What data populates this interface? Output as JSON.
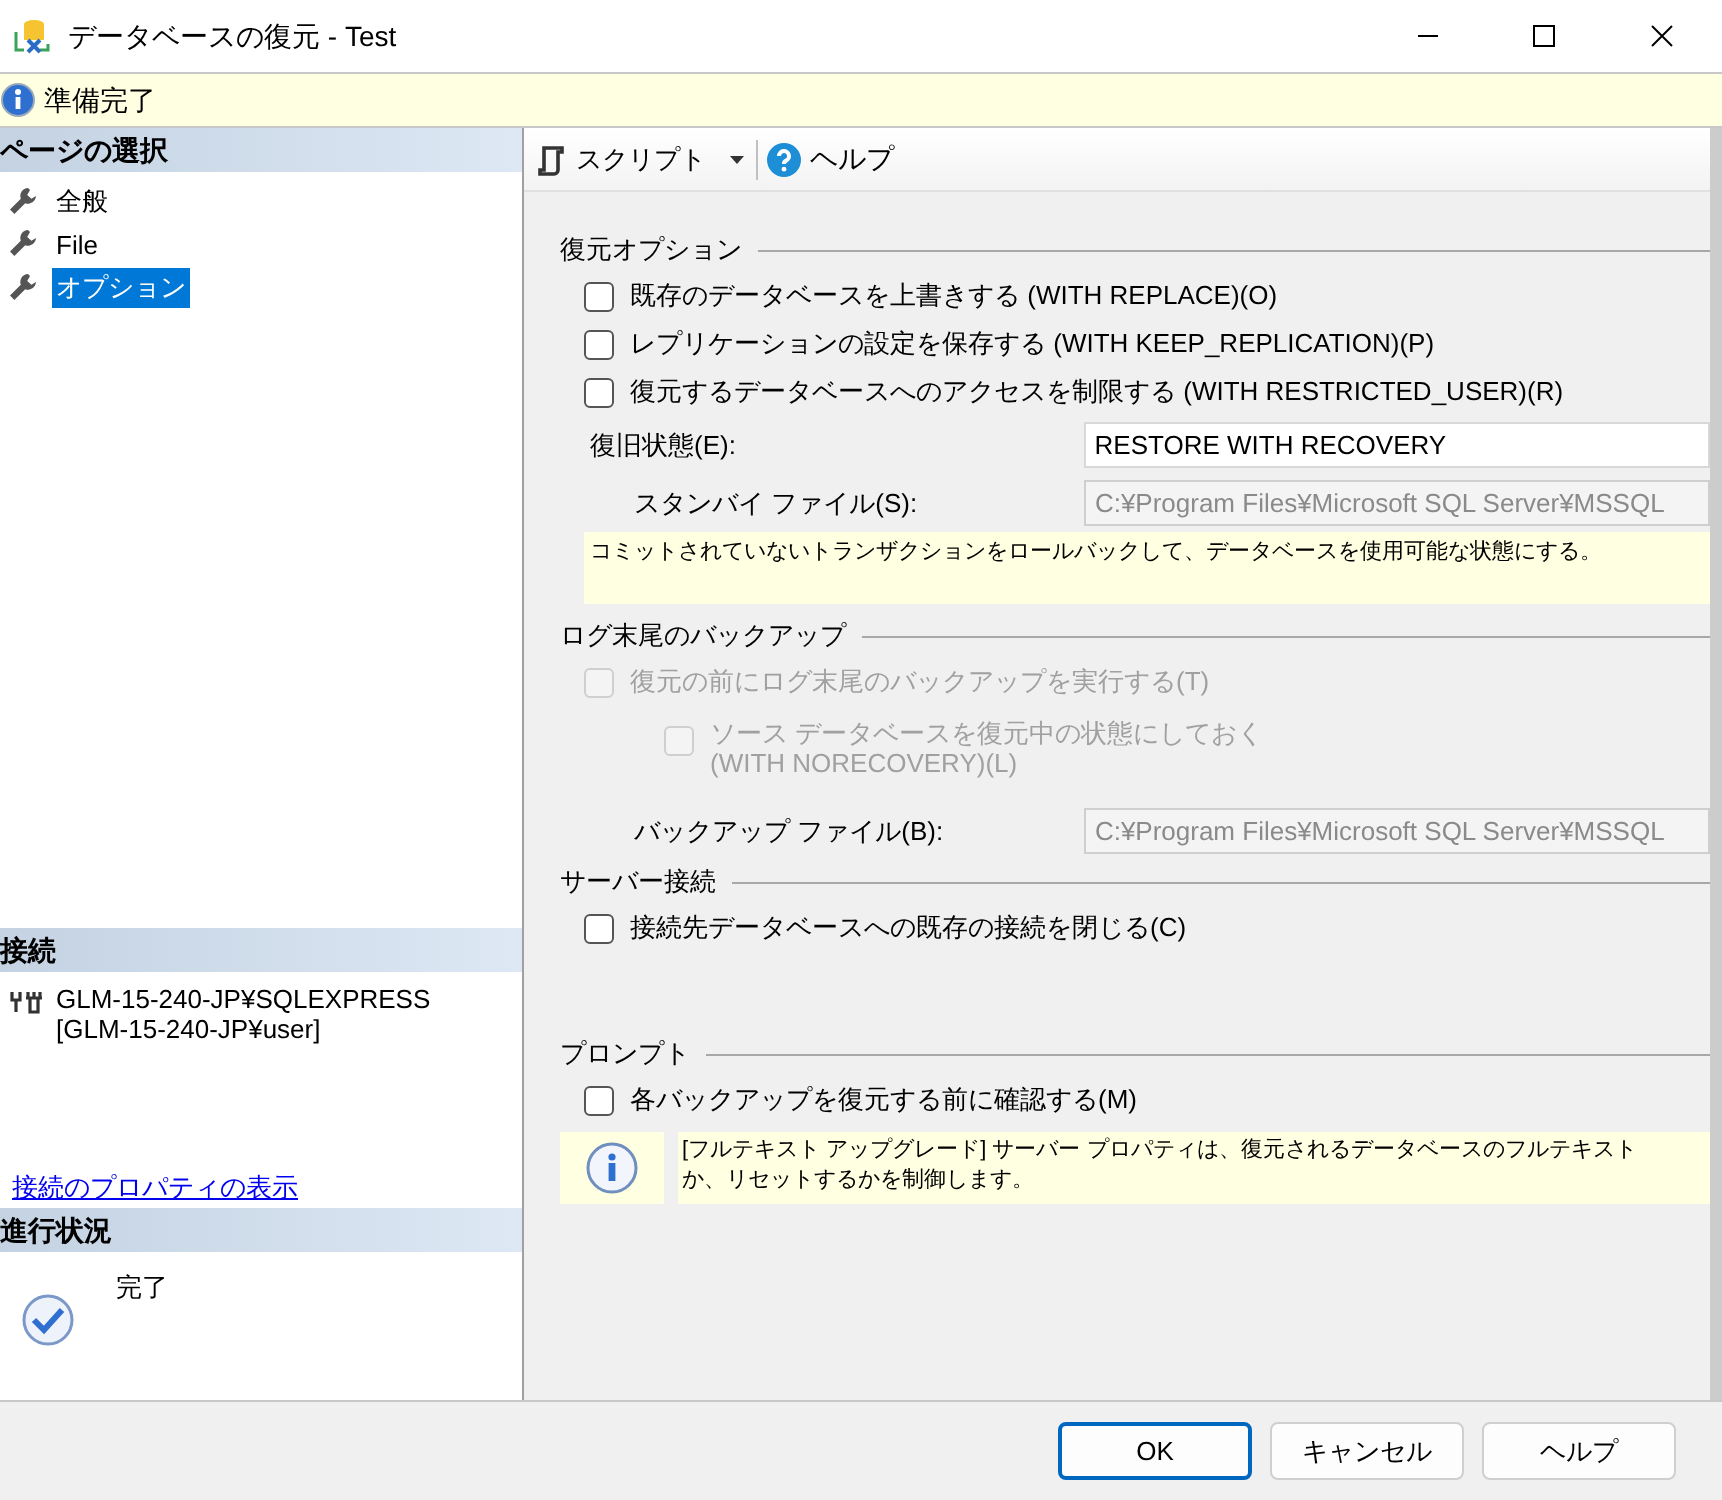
{
  "window": {
    "title": "データベースの復元 - Test"
  },
  "status": {
    "text": "準備完了"
  },
  "sidebar": {
    "pages_header": "ページの選択",
    "pages": [
      {
        "label": "全般",
        "selected": false
      },
      {
        "label": "File",
        "selected": false
      },
      {
        "label": "オプション",
        "selected": true
      }
    ],
    "connection_header": "接続",
    "connection_lines": [
      "GLM-15-240-JP¥SQLEXPRESS",
      "[GLM-15-240-JP¥user]"
    ],
    "connection_link": "接続のプロパティの表示",
    "progress_header": "進行状況",
    "progress_status": "完了"
  },
  "toolbar": {
    "script": "スクリプト",
    "help": "ヘルプ"
  },
  "sections": [
    {
      "title": "復元オプション",
      "items": [
        {
          "kind": "checkbox",
          "label": "既存のデータベースを上書きする (WITH REPLACE)(O)",
          "checked": false,
          "disabled": false
        },
        {
          "kind": "checkbox",
          "label": "レプリケーションの設定を保存する (WITH KEEP_REPLICATION)(P)",
          "checked": false,
          "disabled": false
        },
        {
          "kind": "checkbox",
          "label": "復元するデータベースへのアクセスを制限する (WITH RESTRICTED_USER)(R)",
          "checked": false,
          "disabled": false
        },
        {
          "kind": "dropdown",
          "label": "復旧状態(E):",
          "value": "RESTORE WITH RECOVERY",
          "disabled": false
        },
        {
          "kind": "field",
          "label": "スタンバイ ファイル(S):",
          "value": "C:¥Program Files¥Microsoft SQL Server¥MSSQL",
          "disabled": true
        },
        {
          "kind": "note",
          "text": "コミットされていないトランザクションをロールバックして、データベースを使用可能な状態にする。"
        }
      ]
    },
    {
      "title": "ログ末尾のバックアップ",
      "items": [
        {
          "kind": "checkbox",
          "label": "復元の前にログ末尾のバックアップを実行する(T)",
          "checked": false,
          "disabled": true
        },
        {
          "kind": "subcheckbox",
          "lines": [
            "ソース データベースを復元中の状態にしておく",
            "(WITH NORECOVERY)(L)"
          ],
          "checked": false,
          "disabled": true
        },
        {
          "kind": "field",
          "label": "バックアップ ファイル(B):",
          "value": "C:¥Program Files¥Microsoft SQL Server¥MSSQL",
          "disabled": true
        }
      ]
    },
    {
      "title": "サーバー接続",
      "items": [
        {
          "kind": "checkbox",
          "label": "接続先データベースへの既存の接続を閉じる(C)",
          "checked": false,
          "disabled": false
        }
      ]
    },
    {
      "title": "プロンプト",
      "items": [
        {
          "kind": "checkbox",
          "label": "各バックアップを復元する前に確認する(M)",
          "checked": false,
          "disabled": false
        },
        {
          "kind": "info",
          "lines": [
            "[フルテキスト アップグレード] サーバー プロパティは、復元されるデータベースのフルテキスト",
            "か、リセットするかを制御します。"
          ]
        }
      ]
    }
  ],
  "buttons": [
    {
      "label": "OK",
      "default": true
    },
    {
      "label": "キャンセル",
      "default": false
    },
    {
      "label": "ヘルプ",
      "default": false
    }
  ]
}
